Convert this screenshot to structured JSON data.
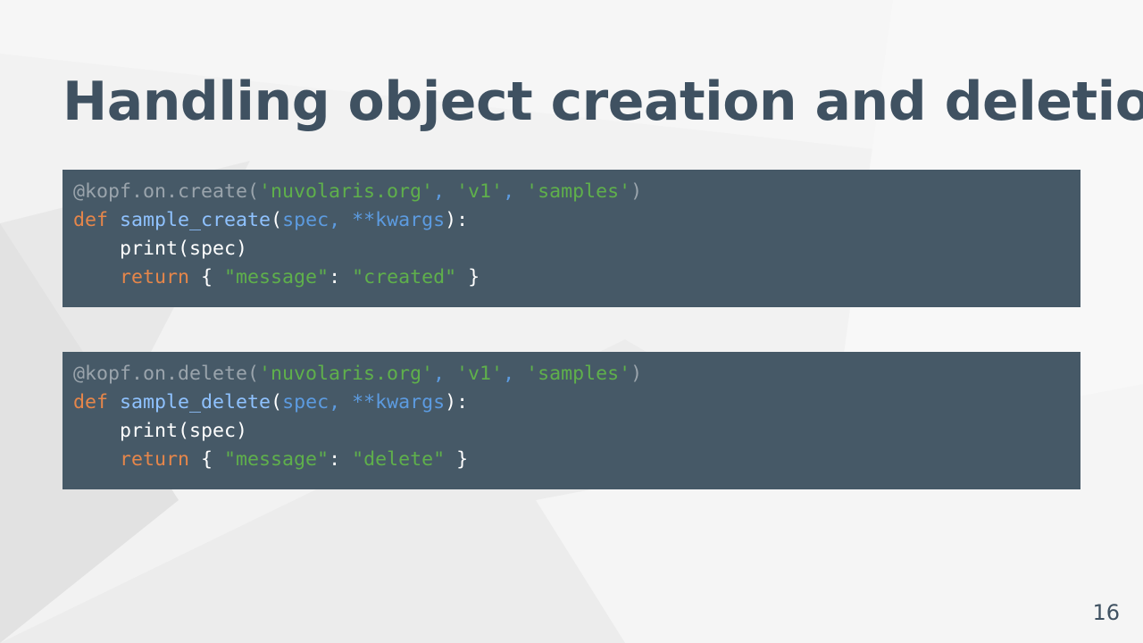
{
  "slide": {
    "title": "Handling object creation and deletion",
    "page_number": "16"
  },
  "code_blocks": [
    {
      "decorator": {
        "prefix": "@kopf.on.create(",
        "arg1": "'nuvolaris.org'",
        "sep1": ", ",
        "arg2": "'v1'",
        "sep2": ", ",
        "arg3": "'samples'",
        "close": ")"
      },
      "def_line": {
        "keyword": "def",
        "fn_name": "sample_create",
        "open": "(",
        "params": "spec, **kwargs",
        "close": "):"
      },
      "print_line": "print(spec)",
      "return_line": {
        "keyword": "return",
        "open": " { ",
        "key": "\"message\"",
        "colon": ": ",
        "value": "\"created\"",
        "close": " }"
      }
    },
    {
      "decorator": {
        "prefix": "@kopf.on.delete(",
        "arg1": "'nuvolaris.org'",
        "sep1": ", ",
        "arg2": "'v1'",
        "sep2": ", ",
        "arg3": "'samples'",
        "close": ")"
      },
      "def_line": {
        "keyword": "def",
        "fn_name": "sample_delete",
        "open": "(",
        "params": "spec, **kwargs",
        "close": "):"
      },
      "print_line": "print(spec)",
      "return_line": {
        "keyword": "return",
        "open": " { ",
        "key": "\"message\"",
        "colon": ": ",
        "value": "\"delete\"",
        "close": " }"
      }
    }
  ],
  "colors": {
    "title": "#3f5161",
    "code_background": "#465967",
    "keyword": "#e6864a",
    "string": "#5fb04b",
    "function": "#8fc2ff",
    "decorator": "#9aa4ac"
  }
}
